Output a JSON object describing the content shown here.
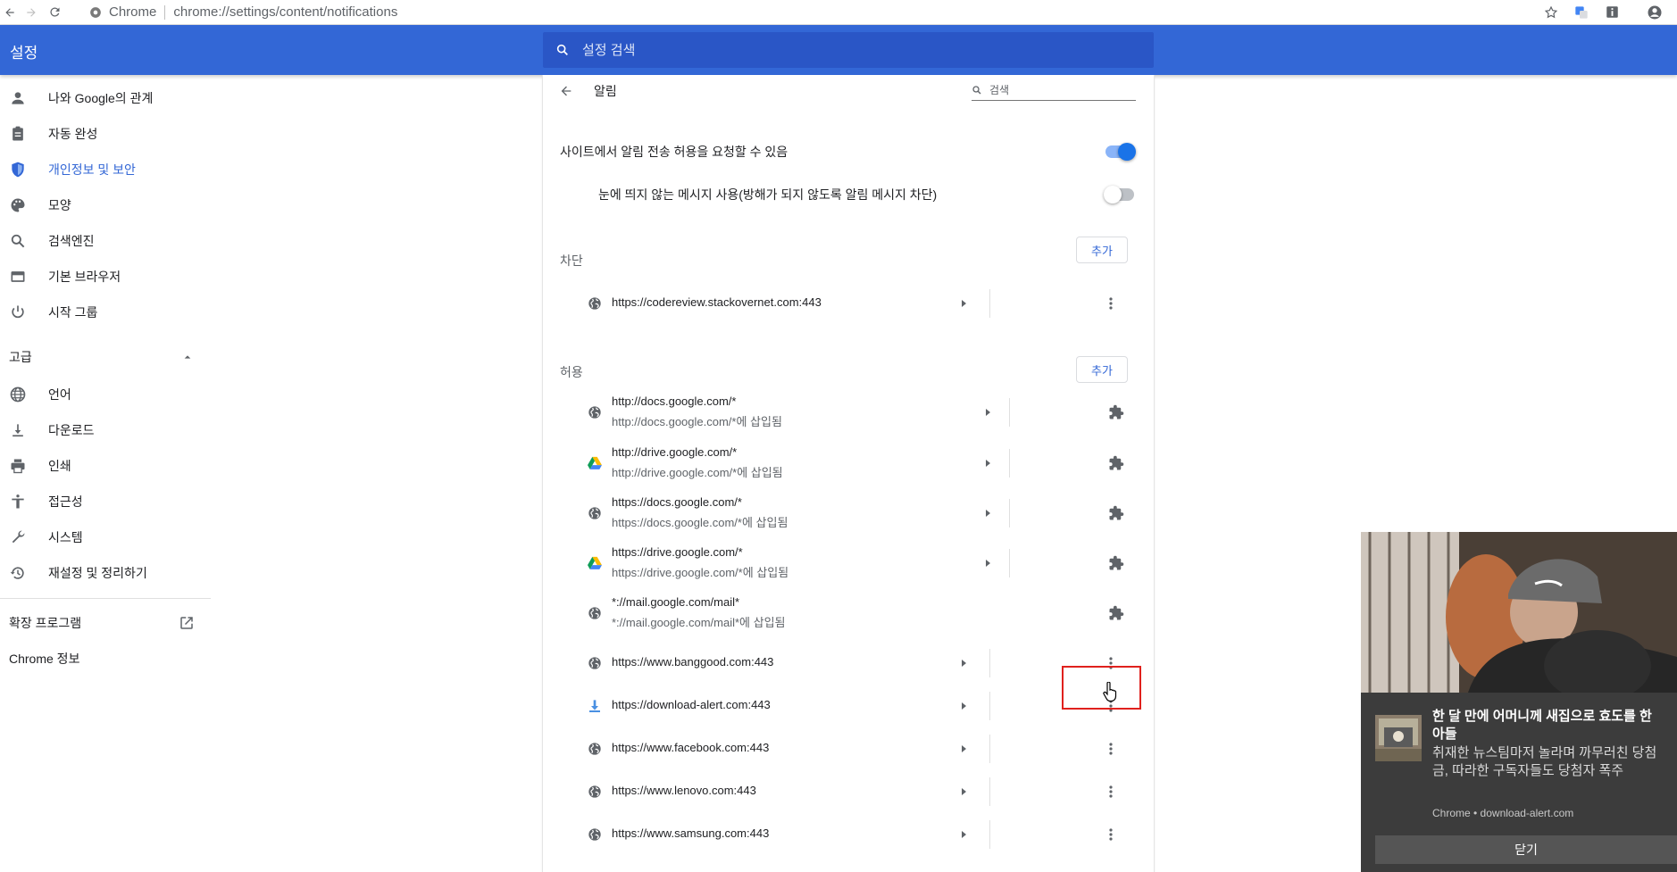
{
  "browser": {
    "site_label": "Chrome",
    "url": "chrome://settings/content/notifications"
  },
  "header": {
    "title": "설정",
    "search_placeholder": "설정 검색"
  },
  "sidebar": {
    "items": [
      {
        "label": "나와 Google의 관계",
        "icon": "person-icon"
      },
      {
        "label": "자동 완성",
        "icon": "clipboard-icon"
      },
      {
        "label": "개인정보 및 보안",
        "icon": "shield-icon",
        "active": true
      },
      {
        "label": "모양",
        "icon": "palette-icon"
      },
      {
        "label": "검색엔진",
        "icon": "search-icon"
      },
      {
        "label": "기본 브라우저",
        "icon": "browser-icon"
      },
      {
        "label": "시작 그룹",
        "icon": "power-icon"
      }
    ],
    "advanced_label": "고급",
    "advanced_items": [
      {
        "label": "언어",
        "icon": "globe-icon"
      },
      {
        "label": "다운로드",
        "icon": "download-icon"
      },
      {
        "label": "인쇄",
        "icon": "printer-icon"
      },
      {
        "label": "접근성",
        "icon": "accessibility-icon"
      },
      {
        "label": "시스템",
        "icon": "wrench-icon"
      },
      {
        "label": "재설정 및 정리하기",
        "icon": "history-icon"
      }
    ],
    "extensions_label": "확장 프로그램",
    "about_label": "Chrome 정보"
  },
  "page": {
    "title": "알림",
    "search_placeholder": "검색",
    "ask_setting": "사이트에서 알림 전송 허용을 요청할 수 있음",
    "ask_enabled": true,
    "quiet_setting": "눈에 띄지 않는 메시지 사용(방해가 되지 않도록 알림 메시지 차단)",
    "quiet_enabled": false,
    "block_label": "차단",
    "allow_label": "허용",
    "add_label": "추가",
    "blocked_sites": [
      {
        "url": "https://codereview.stackovernet.com:443",
        "icon": "globe-icon"
      }
    ],
    "allowed_sites": [
      {
        "url": "http://docs.google.com/*",
        "sub": "http://docs.google.com/*에 삽입됨",
        "icon": "globe-icon",
        "action": "puzzle-icon",
        "arrow": true
      },
      {
        "url": "http://drive.google.com/*",
        "sub": "http://drive.google.com/*에 삽입됨",
        "icon": "drive-icon",
        "action": "puzzle-icon",
        "arrow": true
      },
      {
        "url": "https://docs.google.com/*",
        "sub": "https://docs.google.com/*에 삽입됨",
        "icon": "globe-icon",
        "action": "puzzle-icon",
        "arrow": true
      },
      {
        "url": "https://drive.google.com/*",
        "sub": "https://drive.google.com/*에 삽입됨",
        "icon": "drive-icon",
        "action": "puzzle-icon",
        "arrow": true
      },
      {
        "url": "*://mail.google.com/mail*",
        "sub": "*://mail.google.com/mail*에 삽입됨",
        "icon": "globe-icon",
        "action": "puzzle-icon",
        "arrow": false
      },
      {
        "url": "https://www.banggood.com:443",
        "sub": "",
        "icon": "globe-icon",
        "action": "more-icon",
        "arrow": true
      },
      {
        "url": "https://download-alert.com:443",
        "sub": "",
        "icon": "download-icon",
        "action": "more-icon",
        "arrow": true,
        "highlighted": true
      },
      {
        "url": "https://www.facebook.com:443",
        "sub": "",
        "icon": "globe-icon",
        "action": "more-icon",
        "arrow": true
      },
      {
        "url": "https://www.lenovo.com:443",
        "sub": "",
        "icon": "globe-icon",
        "action": "more-icon",
        "arrow": true
      },
      {
        "url": "https://www.samsung.com:443",
        "sub": "",
        "icon": "globe-icon",
        "action": "more-icon",
        "arrow": true
      }
    ]
  },
  "notification": {
    "title": "한 달 만에 어머니께 새집으로 효도를 한 아들",
    "body": "취재한 뉴스팀마저 놀라며 까무러친 당첨금, 따라한 구독자들도 당첨자 폭주",
    "source": "Chrome • download-alert.com",
    "close_label": "닫기"
  },
  "colors": {
    "header_blue": "#3367d6",
    "search_blue": "#2a56c6",
    "toggle_on": "#1a73e8",
    "highlight_red": "#e0211d",
    "notification_bg": "#3c3c3c"
  }
}
